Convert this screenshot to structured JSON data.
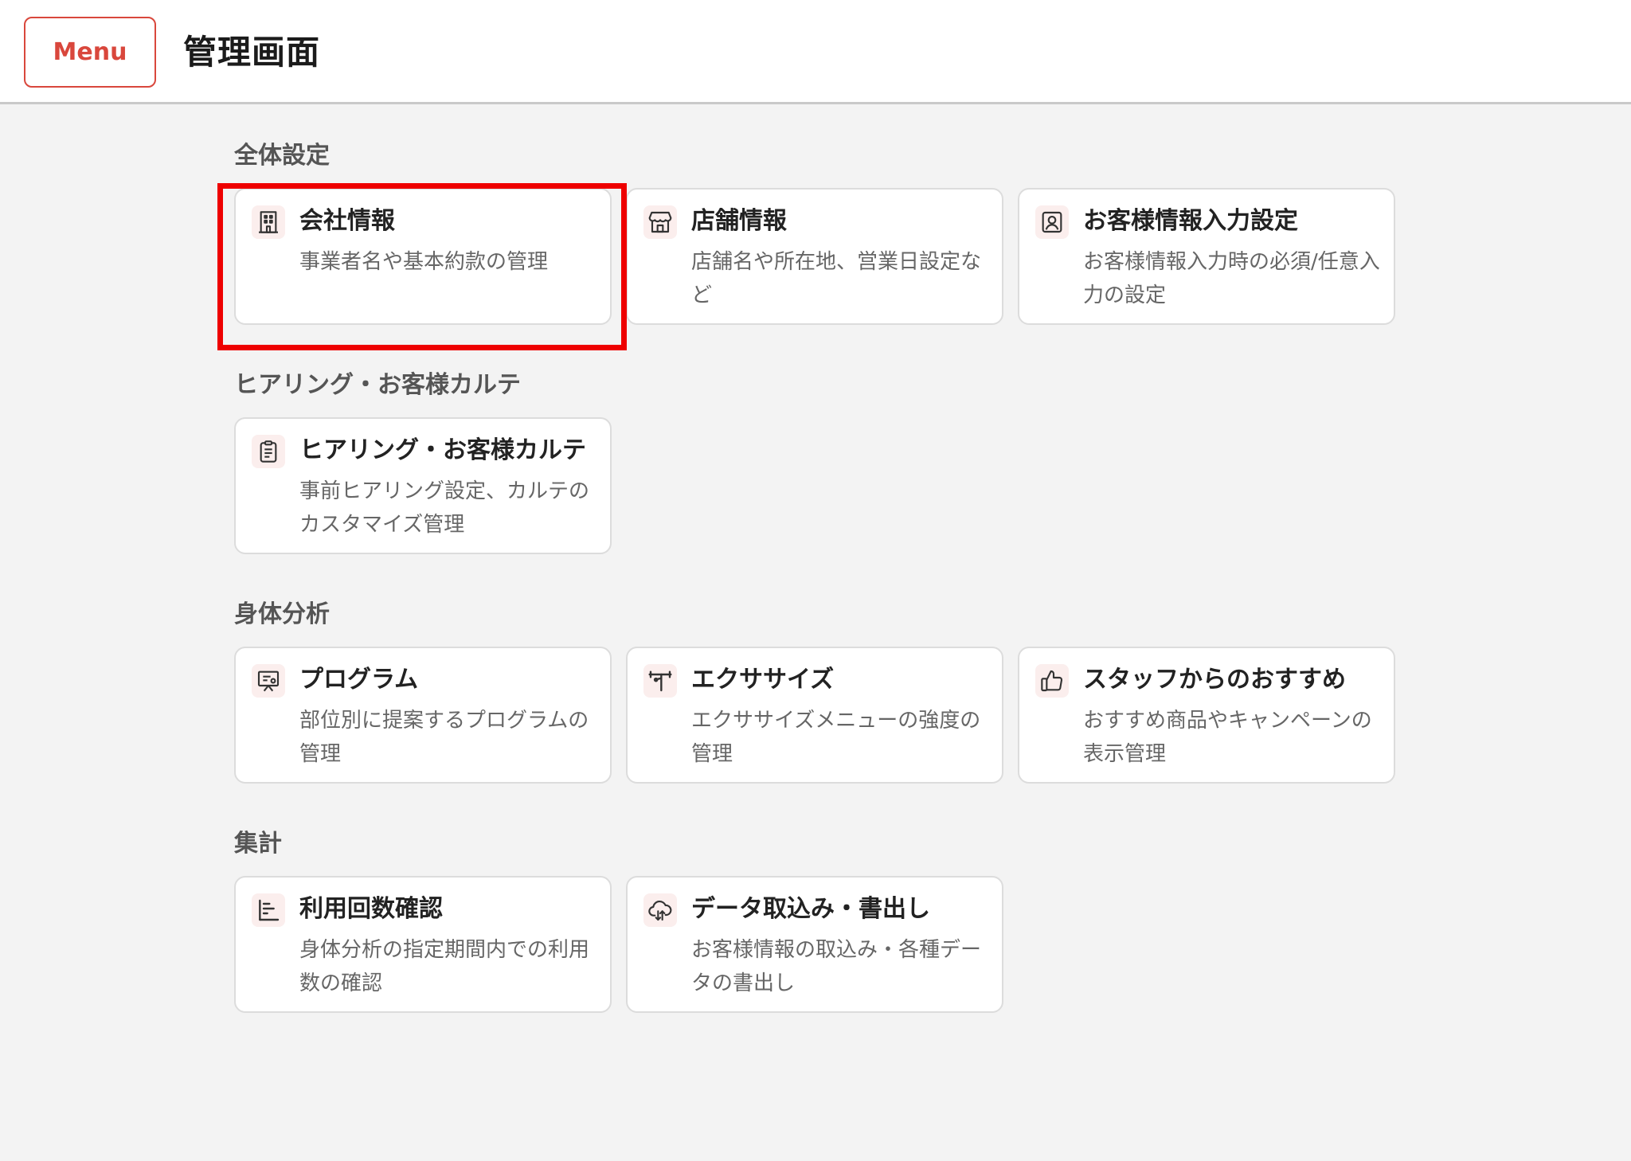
{
  "header": {
    "menu_label": "Menu",
    "title": "管理画面"
  },
  "sections": [
    {
      "title": "全体設定",
      "cards": [
        {
          "icon": "building-icon",
          "title": "会社情報",
          "desc": "事業者名や基本約款の管理"
        },
        {
          "icon": "store-icon",
          "title": "店舗情報",
          "desc": "店舗名や所在地、営業日設定など"
        },
        {
          "icon": "user-card-icon",
          "title": "お客様情報入力設定",
          "desc": "お客様情報入力時の必須/任意入力の設定"
        }
      ]
    },
    {
      "title": "ヒアリング・お客様カルテ",
      "cards": [
        {
          "icon": "clipboard-icon",
          "title": "ヒアリング・お客様カルテ",
          "desc": "事前ヒアリング設定、カルテのカスタマイズ管理"
        }
      ]
    },
    {
      "title": "身体分析",
      "cards": [
        {
          "icon": "presentation-icon",
          "title": "プログラム",
          "desc": "部位別に提案するプログラムの管理"
        },
        {
          "icon": "exercise-icon",
          "title": "エクササイズ",
          "desc": "エクササイズメニューの強度の管理"
        },
        {
          "icon": "thumbs-up-icon",
          "title": "スタッフからのおすすめ",
          "desc": "おすすめ商品やキャンペーンの表示管理"
        }
      ]
    },
    {
      "title": "集計",
      "cards": [
        {
          "icon": "bar-list-icon",
          "title": "利用回数確認",
          "desc": "身体分析の指定期間内での利用数の確認"
        },
        {
          "icon": "cloud-sync-icon",
          "title": "データ取込み・書出し",
          "desc": "お客様情報の取込み・各種データの書出し"
        }
      ]
    }
  ],
  "colors": {
    "accent": "#d9473c",
    "highlight": "#ee0000",
    "background": "#f3f3f3"
  }
}
